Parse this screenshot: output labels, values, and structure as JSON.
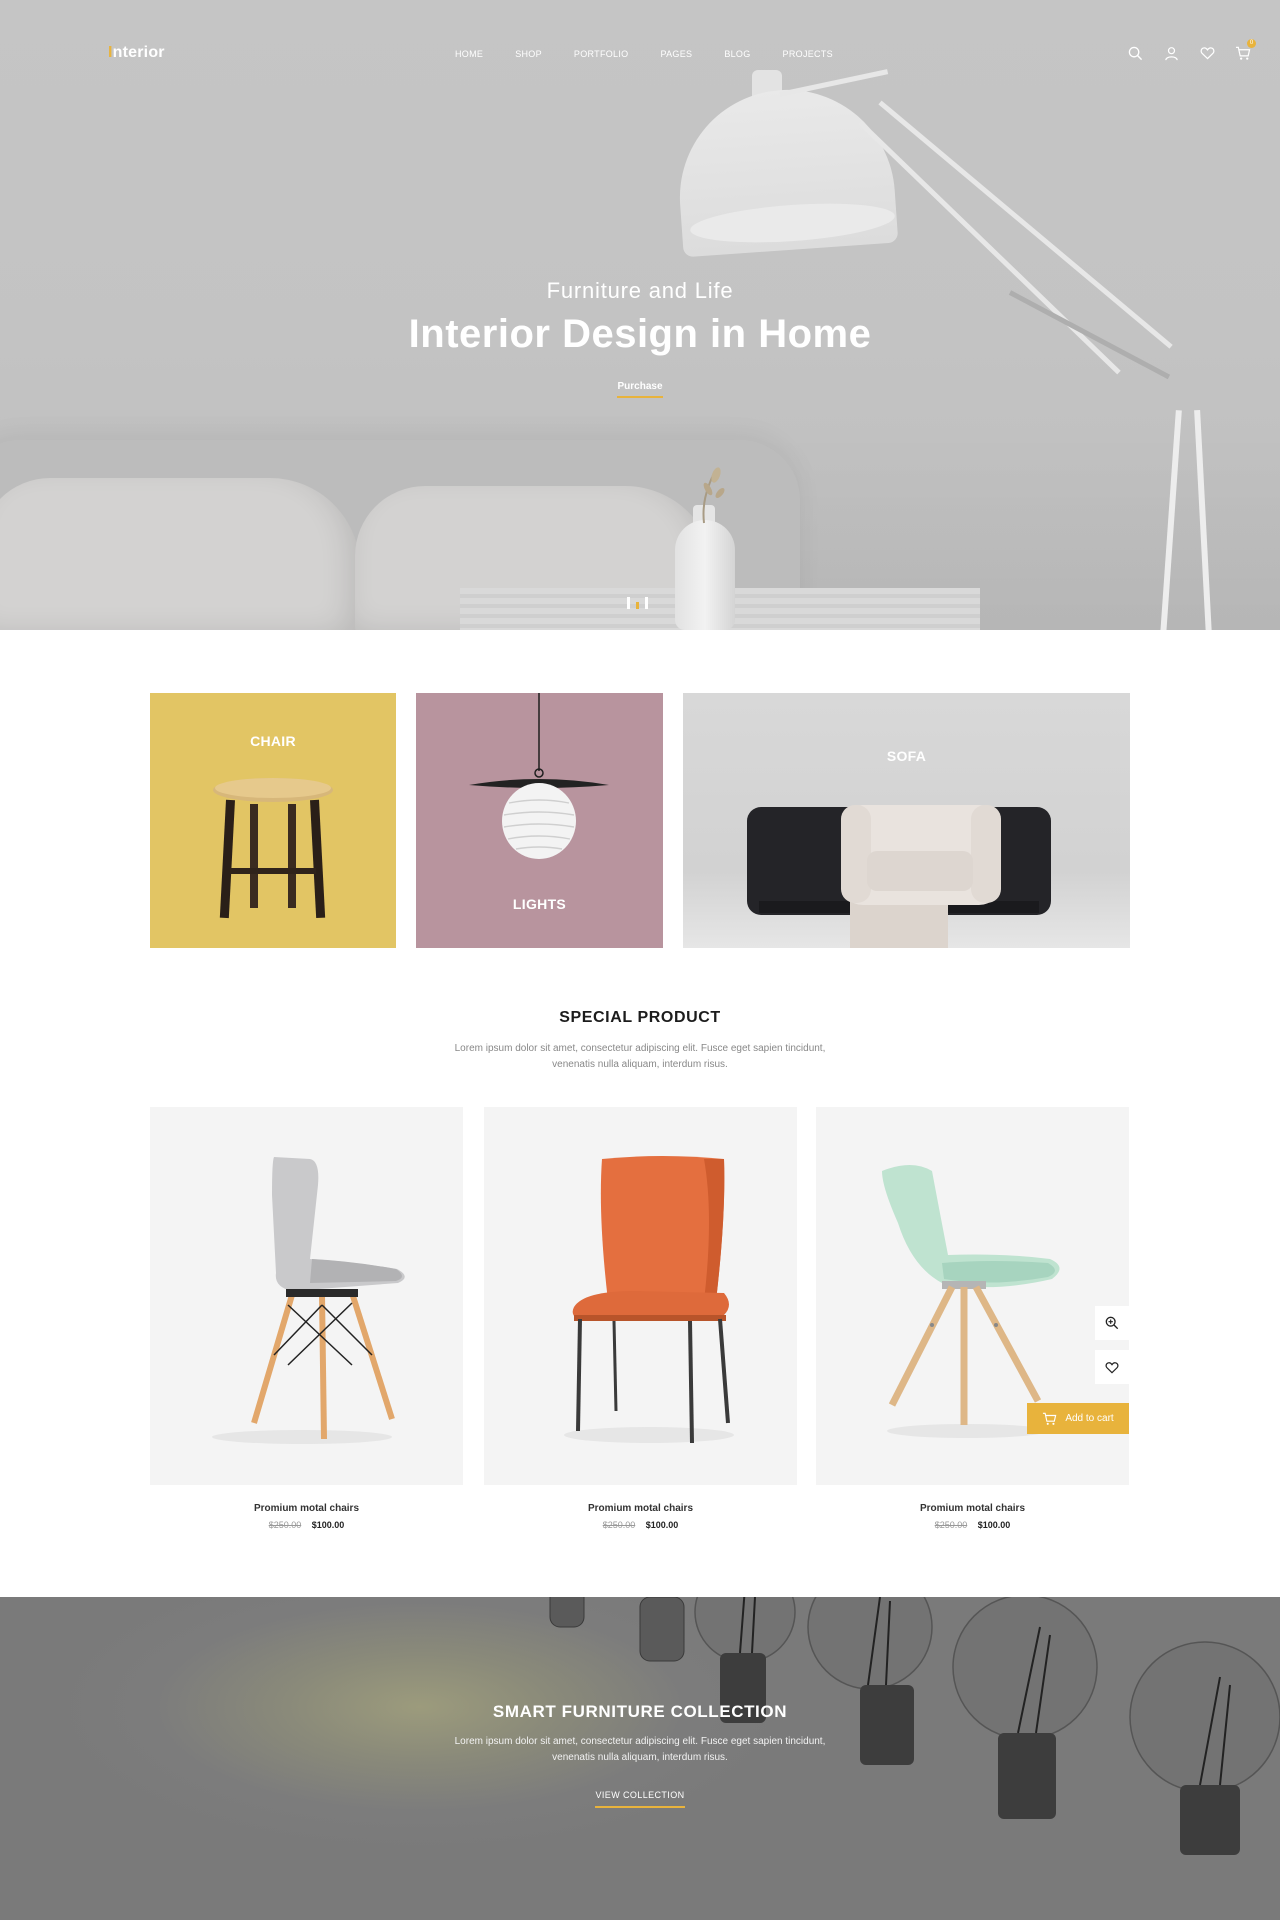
{
  "header": {
    "logo_initial": "I",
    "logo_rest": "nterior",
    "menu": [
      {
        "label": "HOME"
      },
      {
        "label": "SHOP"
      },
      {
        "label": "PORTFOLIO"
      },
      {
        "label": "PAGES"
      },
      {
        "label": "BLOG"
      },
      {
        "label": "PROJECTS"
      }
    ],
    "icons": [
      "search-icon",
      "user-icon",
      "heart-icon",
      "cart-icon"
    ],
    "cart_count": "0"
  },
  "hero": {
    "subtitle": "Furniture and Life",
    "title": "Interior Design in Home",
    "button_label": "Purchase",
    "slides": 3,
    "active_slide": 2
  },
  "categories": [
    {
      "label": "CHAIR"
    },
    {
      "label": "LIGHTS"
    },
    {
      "label": "SOFA"
    }
  ],
  "special": {
    "title": "SPECIAL PRODUCT",
    "desc_line1": "Lorem ipsum dolor sit amet, consectetur adipiscing elit. Fusce eget sapien tincidunt,",
    "desc_line2": "venenatis nulla aliquam, interdum risus."
  },
  "products": [
    {
      "name": "Promium motal chairs",
      "old_price": "$250.00",
      "price": "$100.00"
    },
    {
      "name": "Promium motal chairs",
      "old_price": "$250.00",
      "price": "$100.00"
    },
    {
      "name": "Promium motal chairs",
      "old_price": "$250.00",
      "price": "$100.00",
      "add_to_cart": "Add to cart"
    }
  ],
  "banner": {
    "title": "SMART FURNITURE COLLECTION",
    "desc_line1": "Lorem ipsum dolor sit amet, consectetur adipiscing elit. Fusce eget sapien tincidunt,",
    "desc_line2": "venenatis nulla aliquam, interdum risus.",
    "button_label": "VIEW COLLECTION"
  },
  "colors": {
    "accent": "#e8b33c",
    "chair_tile": "#e2c564",
    "lights_tile": "#b8949e"
  }
}
